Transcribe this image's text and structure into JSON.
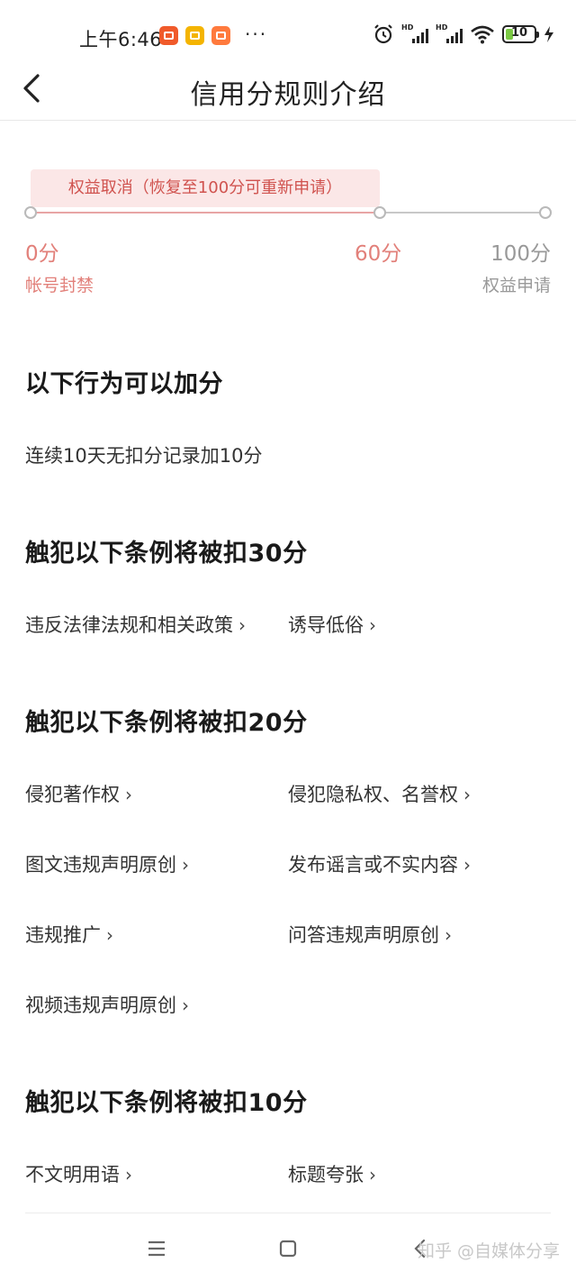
{
  "status_bar": {
    "time": "上午6:46",
    "dots": "···",
    "network_labels": [
      "HD",
      "HD"
    ],
    "battery_level": "10",
    "icons": [
      "video-app-icon",
      "mail-app-icon",
      "shop-app-icon",
      "alarm-icon",
      "signal-icon",
      "wifi-icon",
      "battery-icon",
      "charging-bolt-icon"
    ]
  },
  "header": {
    "title": "信用分规则介绍",
    "back_icon": "chevron-left-icon"
  },
  "scale": {
    "banner": "权益取消（恢复至100分可重新申请）",
    "labels": [
      "0分",
      "60分",
      "100分"
    ],
    "sub_left": "帐号封禁",
    "sub_right": "权益申请",
    "colors": {
      "accent": "#e2807a",
      "banner_bg": "#fbe7e7",
      "banner_text": "#d0534f",
      "muted": "#999999"
    }
  },
  "sections": [
    {
      "title": "以下行为可以加分",
      "text": "连续10天无扣分记录加10分"
    },
    {
      "title": "触犯以下条例将被扣30分",
      "items": [
        "违反法律法规和相关政策",
        "诱导低俗"
      ]
    },
    {
      "title": "触犯以下条例将被扣20分",
      "items": [
        "侵犯著作权",
        "侵犯隐私权、名誉权",
        "图文违规声明原创",
        "发布谣言或不实内容",
        "违规推广",
        "问答违规声明原创",
        "视频违规声明原创"
      ]
    },
    {
      "title": "触犯以下条例将被扣10分",
      "items": [
        "不文明用语",
        "标题夸张"
      ]
    }
  ],
  "chevron": "›",
  "nav": {
    "icons": [
      "menu-icon",
      "home-icon",
      "back-icon"
    ],
    "watermark": "知乎 @自媒体分享"
  }
}
